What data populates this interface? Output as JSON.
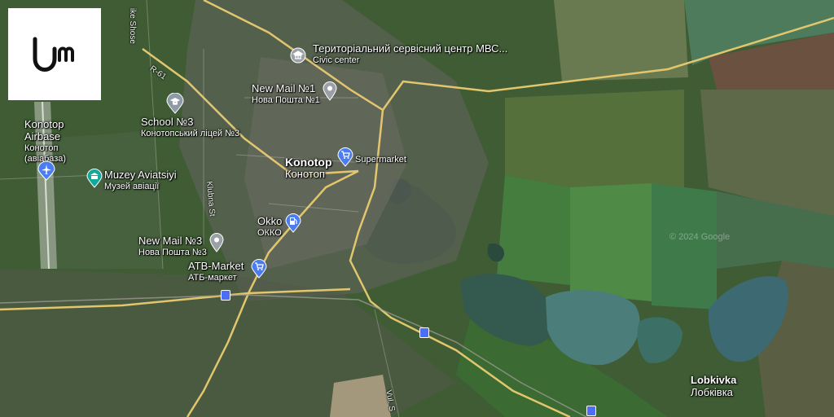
{
  "brand": {
    "logo_text": "UM"
  },
  "attribution": "© 2024 Google",
  "labels": {
    "territorial": {
      "primary": "Територіальний сервісний центр МВС...",
      "secondary": "Civic center"
    },
    "newmail1": {
      "primary": "New Mail №1",
      "secondary": "Нова Пошта №1"
    },
    "school3": {
      "primary": "School №3",
      "secondary": "Конотопський ліцей №3"
    },
    "konotop_airbase": {
      "primary": "Konotop Airbase",
      "secondary": "Конотоп (авіабаза)"
    },
    "muzey": {
      "primary": "Muzey Aviatsiyi",
      "secondary": "Музей авіації"
    },
    "konotop_city": {
      "primary": "Konotop",
      "secondary": "Конотоп"
    },
    "supermarket": {
      "primary": "Supermarket"
    },
    "okko": {
      "primary": "Okko",
      "secondary": "ОККО"
    },
    "newmail3": {
      "primary": "New Mail №3",
      "secondary": "Нова Пошта №3"
    },
    "atb": {
      "primary": "ATB-Market",
      "secondary": "АТБ-маркет"
    },
    "lobkivka": {
      "primary": "Lobkivka",
      "secondary": "Лобківка"
    }
  },
  "roads": {
    "r61": "R-61",
    "shose": "ike Shose",
    "klubna": "Klubna St",
    "vul": "Vul. S"
  },
  "icons": {
    "airport": "airport-icon",
    "museum": "museum-icon",
    "school": "school-icon",
    "government": "government-icon",
    "cart": "shopping-cart-icon",
    "fuel": "fuel-icon",
    "pin": "location-pin-icon",
    "train": "train-station-icon"
  }
}
